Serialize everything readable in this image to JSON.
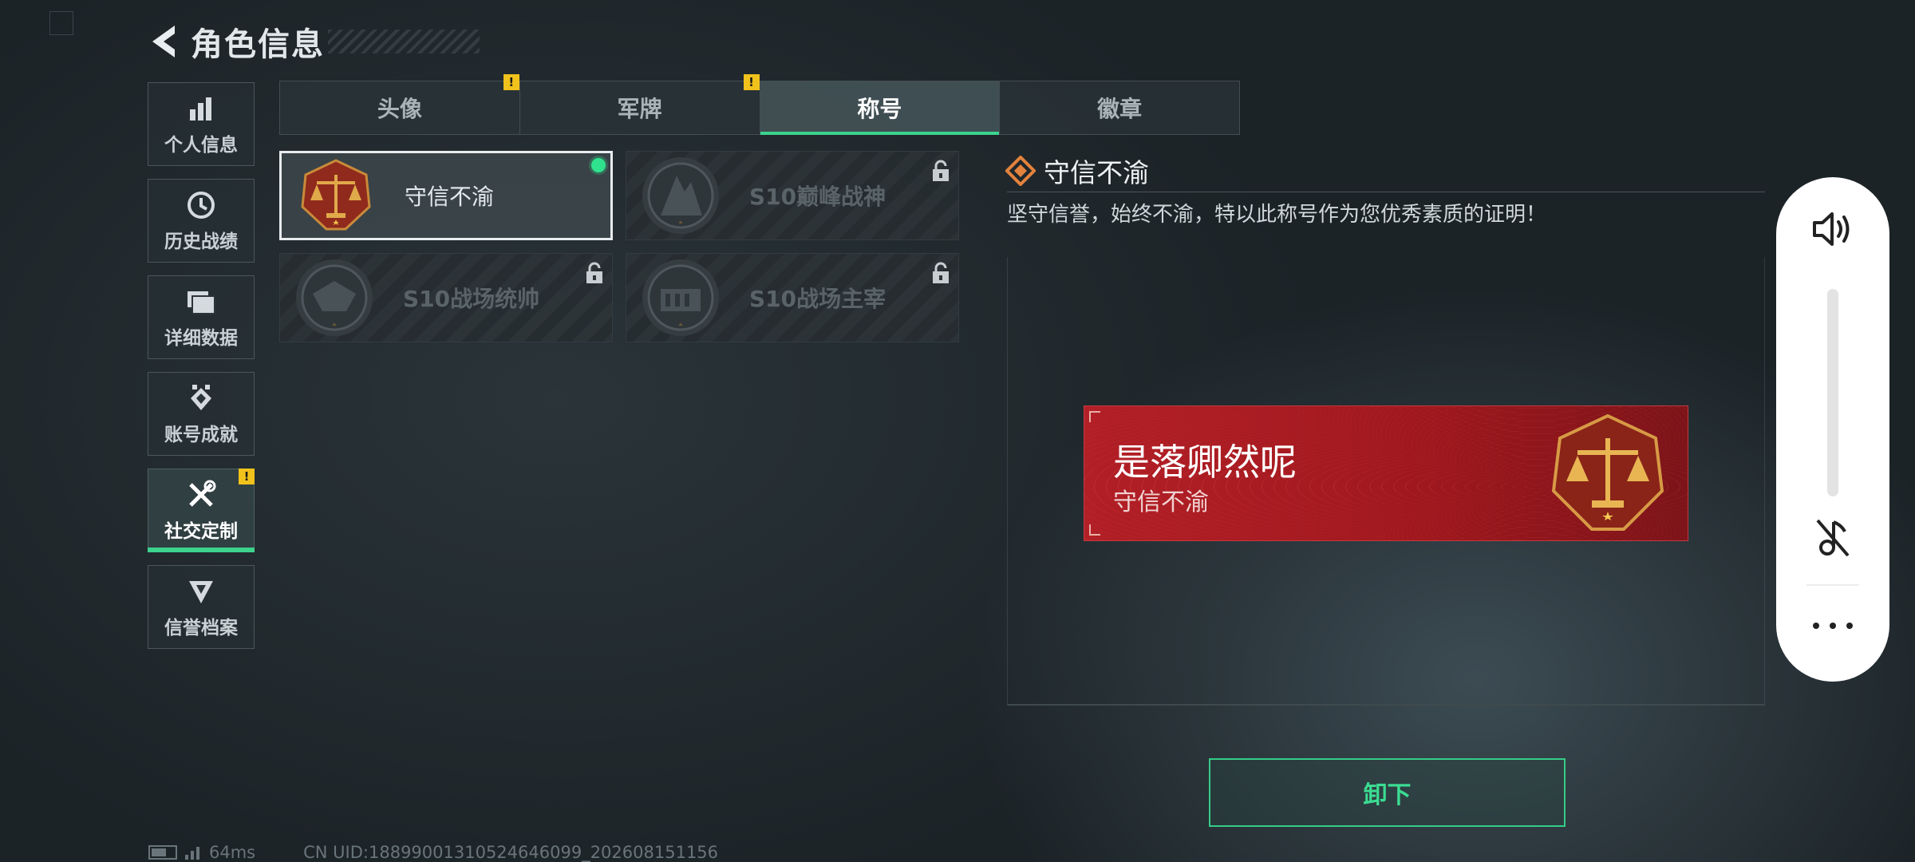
{
  "header": {
    "title": "角色信息"
  },
  "sidebar": {
    "items": [
      {
        "label": "个人信息",
        "icon": "bar-chart-icon"
      },
      {
        "label": "历史战绩",
        "icon": "history-clock-icon"
      },
      {
        "label": "详细数据",
        "icon": "folder-icon"
      },
      {
        "label": "账号成就",
        "icon": "achievement-medal-icon"
      },
      {
        "label": "社交定制",
        "icon": "tools-icon",
        "active": true,
        "alert": "!"
      },
      {
        "label": "信誉档案",
        "icon": "credit-shield-icon"
      }
    ]
  },
  "tabs": [
    {
      "label": "头像",
      "alert": "!"
    },
    {
      "label": "军牌",
      "alert": "!"
    },
    {
      "label": "称号",
      "active": true
    },
    {
      "label": "徽章"
    }
  ],
  "titles": [
    {
      "name": "守信不渝",
      "selected": true,
      "equipped": true,
      "locked": false
    },
    {
      "name": "S10巅峰战神",
      "locked": true
    },
    {
      "name": "S10战场统帅",
      "locked": true
    },
    {
      "name": "S10战场主宰",
      "locked": true
    }
  ],
  "detail": {
    "name": "守信不渝",
    "description": "坚守信誉，始终不渝，特以此称号作为您优秀素质的证明！"
  },
  "banner": {
    "player_name": "是落卿然呢",
    "title": "守信不渝",
    "color": "#b21f26"
  },
  "actions": {
    "unequip_label": "卸下"
  },
  "footer": {
    "ping": "64ms",
    "uid": "CN UID:1889900131052464609​9_202608151156"
  },
  "colors": {
    "accent": "#3cd38e",
    "warning": "#f1c21b"
  }
}
